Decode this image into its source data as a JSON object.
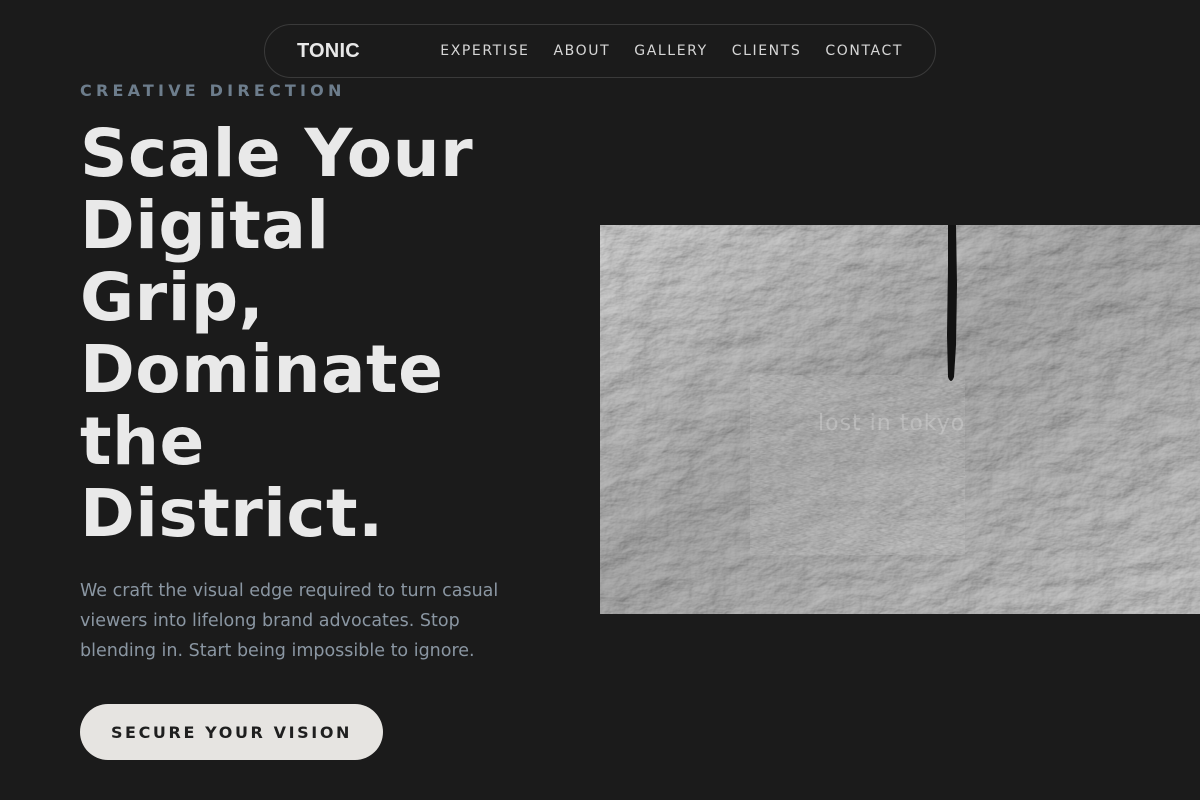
{
  "nav": {
    "brand": "TONIC",
    "links": [
      "EXPERTISE",
      "ABOUT",
      "GALLERY",
      "CLIENTS",
      "CONTACT"
    ]
  },
  "hero": {
    "eyebrow": "CREATIVE DIRECTION",
    "headline_lines": [
      "Scale Your",
      "Digital",
      "Grip,",
      "Dominate",
      "the",
      "District."
    ],
    "lede": "We craft the visual edge required to turn casual viewers into lifelong brand advocates. Stop blending in. Start being impossible to ignore.",
    "cta_label": "SECURE YOUR VISION",
    "image": {
      "description_icon": "textured-plaster-photo",
      "watermark": "lost in tokyo"
    }
  },
  "colors": {
    "background": "#1b1b1b",
    "heading": "#e9e9e9",
    "eyebrow": "#6d7d8c",
    "body": "#8a96a2",
    "cta_bg": "#e6e4e1",
    "cta_text": "#1f1f1f"
  }
}
